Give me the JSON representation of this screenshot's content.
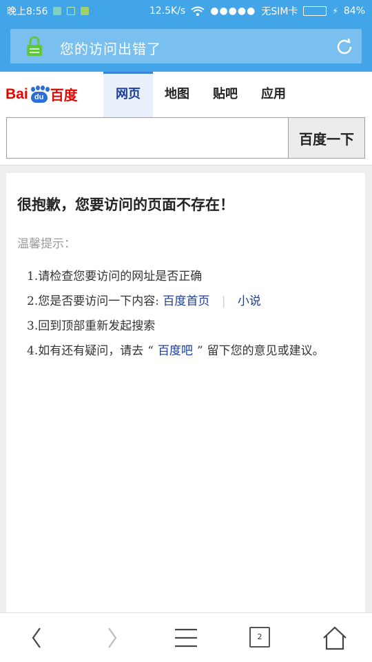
{
  "status": {
    "time": "晚上8:56",
    "speed": "12.5K/s",
    "signal": "●●●●●",
    "carrier": "无SIM卡",
    "battery": "84%",
    "battery_level": 0.84
  },
  "address": {
    "title": "您的访问出错了"
  },
  "header": {
    "logo_latin": "Bai",
    "logo_du": "du",
    "logo_cn": "百度",
    "tabs": [
      "网页",
      "地图",
      "贴吧",
      "应用"
    ]
  },
  "search": {
    "value": "",
    "button": "百度一下"
  },
  "content": {
    "title": "很抱歉，您要访问的页面不存在！",
    "tip": "温馨提示：",
    "items": {
      "i1": "1.请检查您要访问的网址是否正确",
      "i2_prefix": "2.您是否要访问一下内容:",
      "i2_link1": "百度首页",
      "i2_sep": "|",
      "i2_link2": "小说",
      "i3": "3.回到顶部重新发起搜索",
      "i4_prefix": "4.如有还有疑问，请去",
      "i4_q_open": "“",
      "i4_link": "百度吧",
      "i4_q_close": "”",
      "i4_suffix": "留下您的意见或建议。"
    }
  },
  "bottom": {
    "tab_count": "2"
  }
}
